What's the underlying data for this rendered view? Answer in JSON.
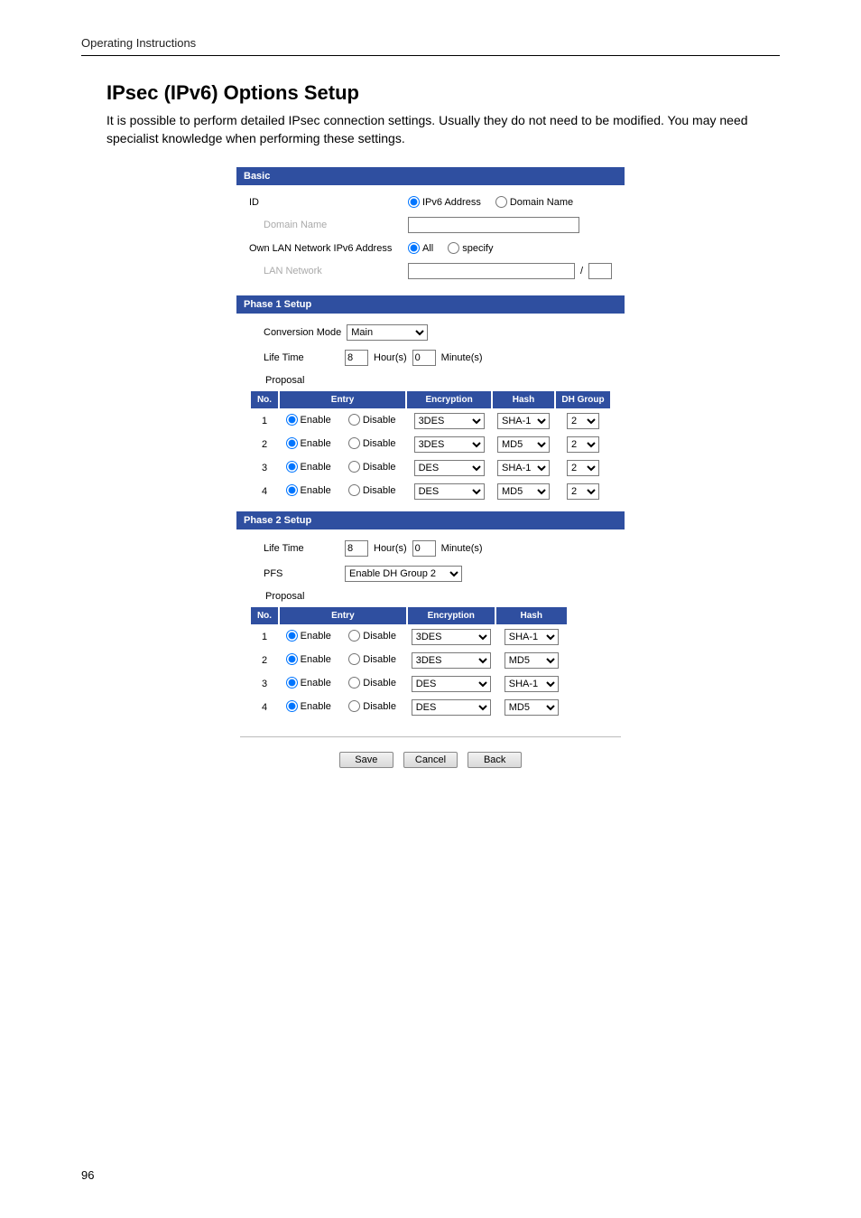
{
  "page": {
    "running_header": "Operating Instructions",
    "page_number": "96"
  },
  "heading": {
    "title": "IPsec (IPv6) Options Setup",
    "intro": "It is possible to perform detailed IPsec connection settings. Usually they do not need to be modified. You may need specialist knowledge when performing these settings."
  },
  "form": {
    "basic": {
      "bar": "Basic",
      "id_label": "ID",
      "id_opt1": "IPv6 Address",
      "id_opt2": "Domain Name",
      "id_domain_label": "Domain Name",
      "id_domain_value": "",
      "own_lan_label": "Own LAN Network IPv6 Address",
      "own_opt1": "All",
      "own_opt2": "specify",
      "own_lan_net_label": "LAN Network",
      "own_lan_value": "",
      "slash": "/",
      "own_prefix_value": ""
    },
    "phase1": {
      "bar": "Phase 1 Setup",
      "conv_label": "Conversion Mode",
      "conv_value": "Main",
      "life_label": "Life Time",
      "life_hours": "8",
      "life_hours_unit": "Hour(s)",
      "life_min": "0",
      "life_min_unit": "Minute(s)",
      "proposal_label": "Proposal",
      "headers": {
        "no": "No.",
        "entry": "Entry",
        "enc": "Encryption",
        "hash": "Hash",
        "dh": "DH Group"
      },
      "entry_enable": "Enable",
      "entry_disable": "Disable",
      "rows": [
        {
          "no": "1",
          "enc": "3DES",
          "hash": "SHA-1",
          "dh": "2"
        },
        {
          "no": "2",
          "enc": "3DES",
          "hash": "MD5",
          "dh": "2"
        },
        {
          "no": "3",
          "enc": "DES",
          "hash": "SHA-1",
          "dh": "2"
        },
        {
          "no": "4",
          "enc": "DES",
          "hash": "MD5",
          "dh": "2"
        }
      ]
    },
    "phase2": {
      "bar": "Phase 2 Setup",
      "life_label": "Life Time",
      "life_hours": "8",
      "life_hours_unit": "Hour(s)",
      "life_min": "0",
      "life_min_unit": "Minute(s)",
      "pfs_label": "PFS",
      "pfs_value": "Enable DH Group 2",
      "proposal_label": "Proposal",
      "headers": {
        "no": "No.",
        "entry": "Entry",
        "enc": "Encryption",
        "hash": "Hash"
      },
      "entry_enable": "Enable",
      "entry_disable": "Disable",
      "rows": [
        {
          "no": "1",
          "enc": "3DES",
          "hash": "SHA-1"
        },
        {
          "no": "2",
          "enc": "3DES",
          "hash": "MD5"
        },
        {
          "no": "3",
          "enc": "DES",
          "hash": "SHA-1"
        },
        {
          "no": "4",
          "enc": "DES",
          "hash": "MD5"
        }
      ]
    },
    "buttons": {
      "save": "Save",
      "cancel": "Cancel",
      "back": "Back"
    }
  }
}
